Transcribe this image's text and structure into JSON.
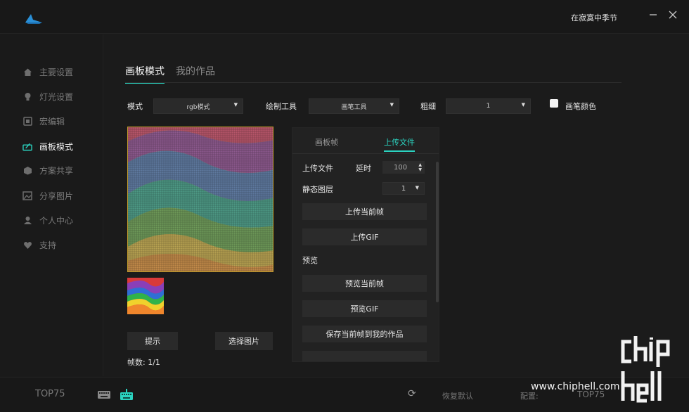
{
  "titlebar": {
    "username": "在寂寞中季节",
    "minimize_icon": "minimize-icon",
    "close_icon": "close-icon",
    "brand_color": "#2a8fd6"
  },
  "sidebar": {
    "items": [
      {
        "label": "主要设置",
        "icon": "home-icon",
        "active": false
      },
      {
        "label": "灯光设置",
        "icon": "bulb-icon",
        "active": false
      },
      {
        "label": "宏编辑",
        "icon": "macro-icon",
        "active": false
      },
      {
        "label": "画板模式",
        "icon": "drawing-board-icon",
        "active": true
      },
      {
        "label": "方案共享",
        "icon": "cube-icon",
        "active": false
      },
      {
        "label": "分享图片",
        "icon": "image-icon",
        "active": false
      },
      {
        "label": "个人中心",
        "icon": "user-icon",
        "active": false
      },
      {
        "label": "支持",
        "icon": "heart-icon",
        "active": false
      }
    ]
  },
  "main": {
    "tabs": [
      {
        "label": "画板模式",
        "active": true
      },
      {
        "label": "我的作品",
        "active": false
      }
    ],
    "controls": {
      "mode_label": "模式",
      "mode_value": "rgb模式",
      "tool_label": "绘制工具",
      "tool_value": "画笔工具",
      "thickness_label": "粗细",
      "thickness_value": "1",
      "brush_color_label": "画笔颜色",
      "brush_color_checked": false
    },
    "hint_button": "提示",
    "select_image_button": "选择图片",
    "frames_text": "帧数: 1/1",
    "accent_color": "#2bd3c0"
  },
  "panel": {
    "tabs": [
      {
        "label": "画板帧",
        "active": false
      },
      {
        "label": "上传文件",
        "active": true
      }
    ],
    "upload_file_label": "上传文件",
    "delay_label": "延时",
    "delay_value": "100",
    "static_layer_label": "静态图层",
    "static_layer_value": "1",
    "upload_current_frame": "上传当前帧",
    "upload_gif": "上传GIF",
    "preview_label": "预览",
    "preview_current_frame": "预览当前帧",
    "preview_gif": "预览GIF",
    "save_current_frame": "保存当前帧到我的作品"
  },
  "bottombar": {
    "device_name": "TOP75",
    "reset_label": "恢复默认",
    "config_label": "配置:",
    "config_value": "TOP75"
  },
  "watermark": {
    "site": "www.chiphell.com",
    "logo_text": "chip hell"
  }
}
